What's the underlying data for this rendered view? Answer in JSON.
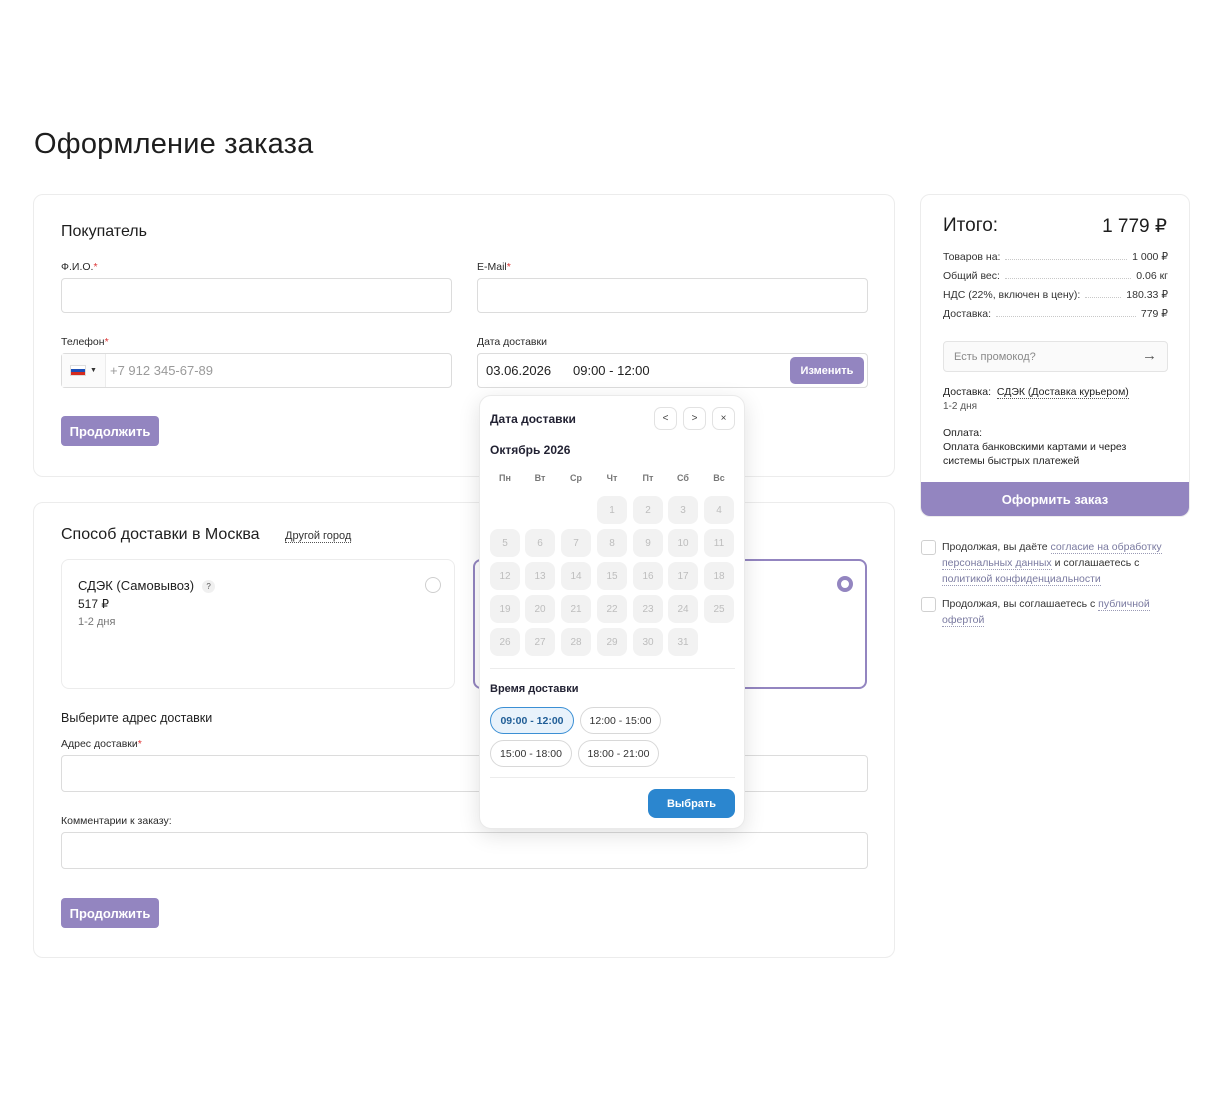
{
  "page": {
    "title": "Оформление заказа"
  },
  "buyer": {
    "title": "Покупатель",
    "fio_label": "Ф.И.О.",
    "email_label": "E-Mail",
    "phone_label": "Телефон",
    "phone_placeholder": "+7 912 345-67-89",
    "date_label": "Дата доставки",
    "date_value": "03.06.2026",
    "time_value": "09:00 - 12:00",
    "change_button": "Изменить",
    "continue_button": "Продолжить",
    "required_mark": "*"
  },
  "delivery": {
    "title": "Способ доставки в Москва",
    "other_city": "Другой город",
    "option1": {
      "name": "СДЭК (Самовывоз)",
      "price": "517 ₽",
      "term": "1-2 дня",
      "help": "?"
    },
    "address_section": "Выберите адрес доставки",
    "address_label": "Адрес доставки",
    "comment_label": "Комментарии к заказу:",
    "continue_button": "Продолжить"
  },
  "summary": {
    "title": "Итого:",
    "total": "1 779 ₽",
    "rows": [
      {
        "label": "Товаров на:",
        "value": "1 000 ₽"
      },
      {
        "label": "Общий вес:",
        "value": "0.06 кг"
      },
      {
        "label": "НДС (22%, включен в цену):",
        "value": "180.33 ₽"
      },
      {
        "label": "Доставка:",
        "value": "779 ₽"
      }
    ],
    "promo_placeholder": "Есть промокод?",
    "delivery_label": "Доставка:",
    "delivery_value": "СДЭК (Доставка курьером)",
    "delivery_term": "1-2 дня",
    "payment_label": "Оплата:",
    "payment_value": "Оплата банковскими картами и через системы быстрых платежей",
    "order_button": "Оформить заказ"
  },
  "consents": [
    {
      "before": "Продолжая, вы даёте ",
      "link": "согласие на обработку персональных данных",
      "middle": " и соглашаетесь с ",
      "link2": "политикой конфиденциальности"
    },
    {
      "before": "Продолжая, вы соглашаетесь с ",
      "link": "публичной офертой"
    }
  ],
  "calendar": {
    "title": "Дата доставки",
    "prev": "<",
    "next": ">",
    "close": "×",
    "month": "Октябрь 2026",
    "weekdays": [
      "Пн",
      "Вт",
      "Ср",
      "Чт",
      "Пт",
      "Сб",
      "Вс"
    ],
    "first_weekday": 3,
    "days_in_month": 31,
    "time_title": "Время доставки",
    "slots": [
      {
        "label": "09:00 - 12:00",
        "active": true
      },
      {
        "label": "12:00 - 15:00",
        "active": false
      },
      {
        "label": "15:00 - 18:00",
        "active": false
      },
      {
        "label": "18:00 - 21:00",
        "active": false
      }
    ],
    "select_button": "Выбрать"
  },
  "colors": {
    "accent": "#9385c0",
    "select": "#2b86cf",
    "flag_white": "#ffffff",
    "flag_blue": "#1c4fb8",
    "flag_red": "#d52b1e"
  },
  "icons": {
    "country": "russia-flag-icon",
    "promo": "arrow-right-icon"
  }
}
